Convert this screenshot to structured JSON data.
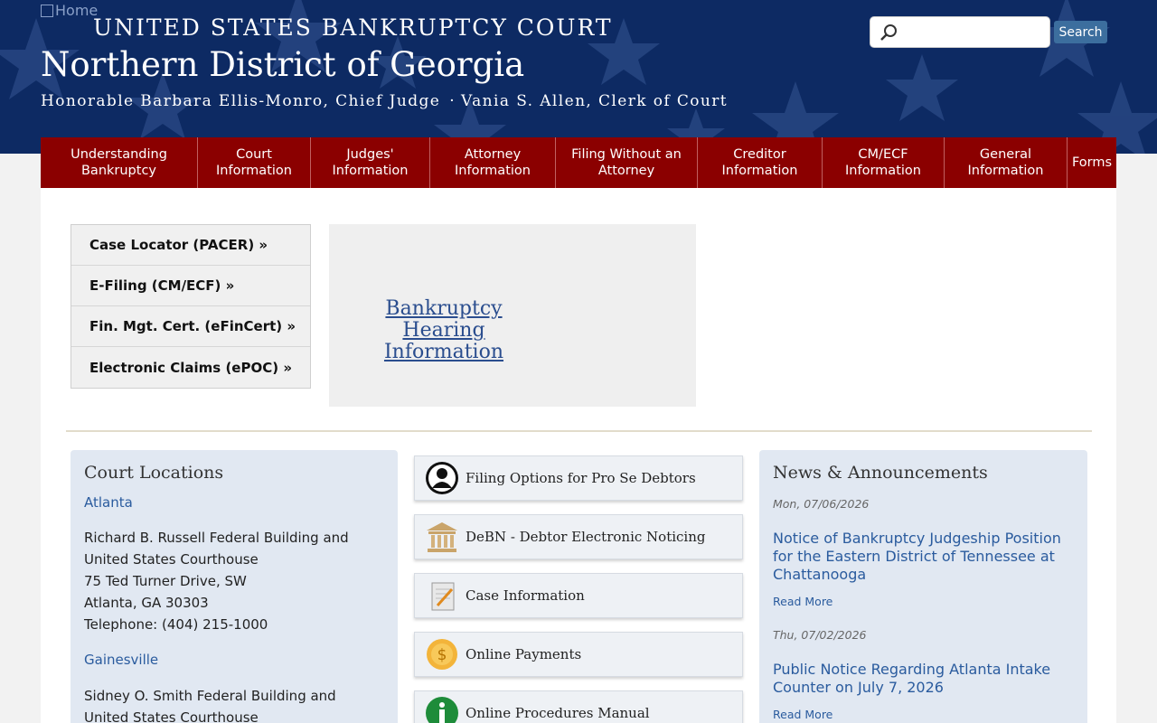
{
  "header": {
    "home_alt": "Home",
    "court_name": "UNITED STATES BANKRUPTCY COURT",
    "district": "Northern District of Georgia",
    "chief_judge": "Honorable Barbara Ellis-Monro, Chief Judge",
    "separator": "·",
    "clerk": "Vania S. Allen, Clerk of Court",
    "search_placeholder": "",
    "search_button": "Search"
  },
  "nav": {
    "items": [
      {
        "label": "Understanding Bankruptcy"
      },
      {
        "label": "Court Information"
      },
      {
        "label": "Judges' Information"
      },
      {
        "label": "Attorney Information"
      },
      {
        "label": "Filing Without an Attorney"
      },
      {
        "label": "Creditor Information"
      },
      {
        "label": "CM/ECF Information"
      },
      {
        "label": "General Information"
      },
      {
        "label": "Forms"
      }
    ]
  },
  "quick_links": [
    {
      "label": "Case Locator (PACER) »"
    },
    {
      "label": "E-Filing (CM/ECF) »"
    },
    {
      "label": "Fin. Mgt. Cert. (eFinCert) »"
    },
    {
      "label": "Electronic Claims (ePOC) »"
    }
  ],
  "hearing": {
    "label": "Bankruptcy Hearing Information"
  },
  "locations": {
    "title": "Court Locations",
    "cities": [
      {
        "name": "Atlanta",
        "address": [
          "Richard B. Russell Federal Building and",
          "United States Courthouse",
          "75 Ted Turner Drive, SW",
          "Atlanta, GA 30303",
          "Telephone: (404) 215-1000"
        ]
      },
      {
        "name": "Gainesville",
        "address": [
          "Sidney O. Smith Federal Building and",
          "United States Courthouse"
        ]
      }
    ]
  },
  "tiles": [
    {
      "label": "Filing Options for Pro Se Debtors",
      "icon": "person-icon"
    },
    {
      "label": "DeBN - Debtor Electronic Noticing",
      "icon": "courthouse-icon"
    },
    {
      "label": "Case Information",
      "icon": "notepad-icon"
    },
    {
      "label": "Online Payments",
      "icon": "coin-icon"
    },
    {
      "label": "Online Procedures Manual",
      "icon": "info-icon"
    }
  ],
  "news": {
    "title": "News & Announcements",
    "items": [
      {
        "date": "Mon, 07/06/2026",
        "title": "Notice of Bankruptcy Judgeship Position for the Eastern District of Tennessee at Chattanooga",
        "more": "Read More"
      },
      {
        "date": "Thu, 07/02/2026",
        "title": "Public Notice Regarding Atlanta Intake Counter on July 7, 2026",
        "more": "Read More"
      }
    ]
  },
  "colors": {
    "header_bg": "#0d2a63",
    "nav_bg": "#8b0000",
    "link": "#2a5b9e",
    "box_bg": "#e1e8f2"
  }
}
